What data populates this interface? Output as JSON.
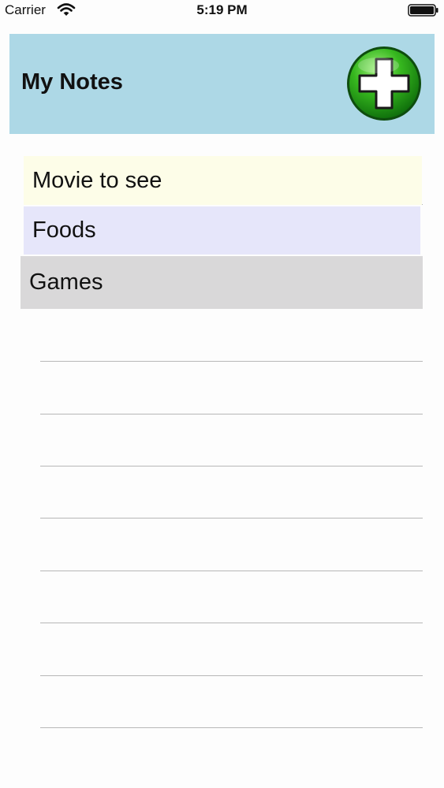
{
  "status_bar": {
    "carrier": "Carrier",
    "time": "5:19 PM",
    "wifi_icon": "wifi-icon",
    "battery_icon": "battery-icon"
  },
  "header": {
    "title": "My Notes",
    "background": "#add8e6",
    "add_button_icon": "green-plus-icon"
  },
  "notes": [
    {
      "label": "Movie to see",
      "color": "#fdfde8"
    },
    {
      "label": "Foods",
      "color": "#e6e6fa"
    },
    {
      "label": "Games",
      "color": "#d9d8d9"
    }
  ]
}
